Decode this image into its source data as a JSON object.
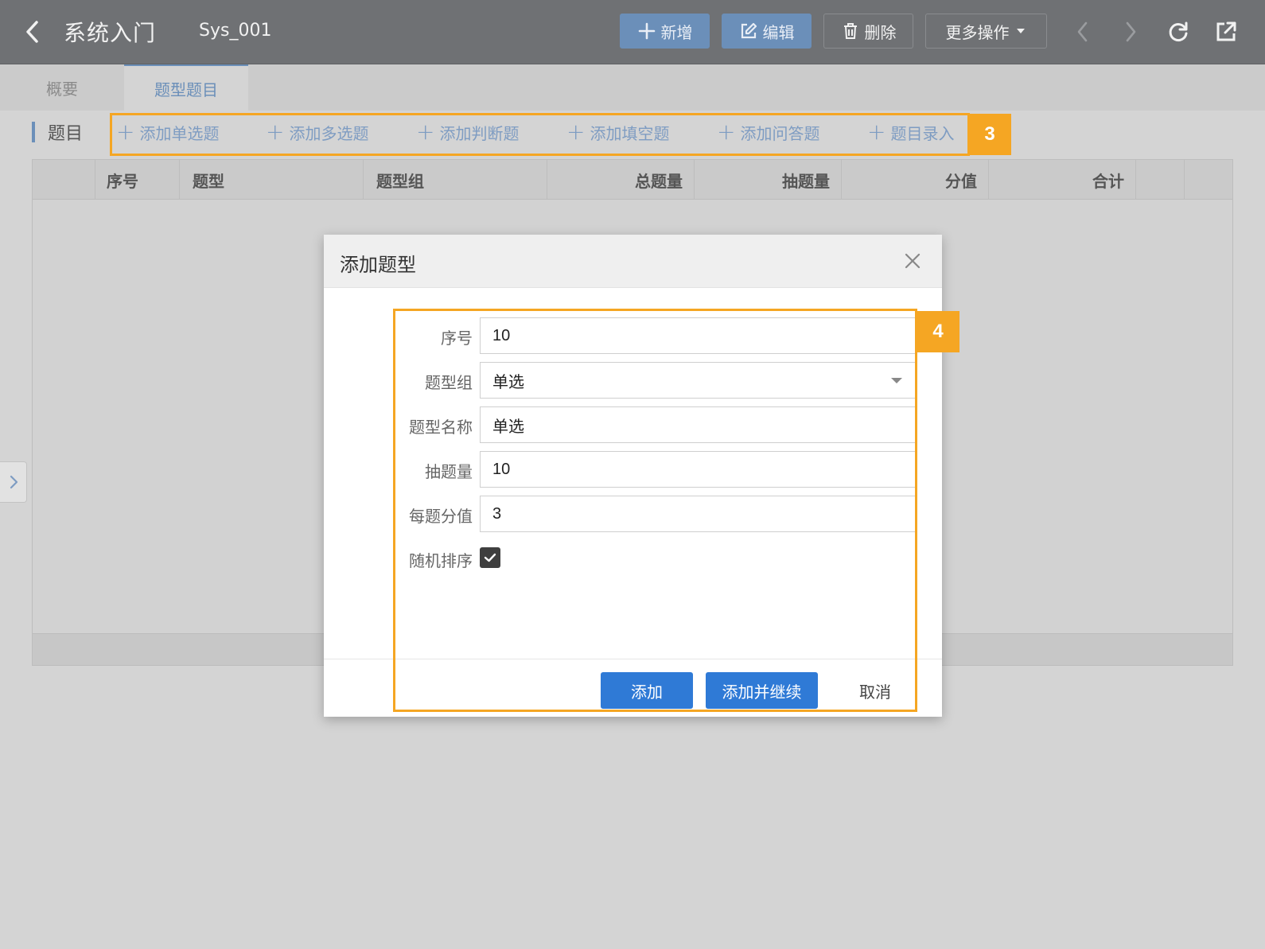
{
  "header": {
    "title": "系统入门",
    "code": "Sys_001",
    "buttons": {
      "add": "新增",
      "edit": "编辑",
      "delete": "删除",
      "more": "更多操作"
    }
  },
  "tabs": [
    {
      "label": "概要",
      "active": false
    },
    {
      "label": "题型题目",
      "active": true
    }
  ],
  "section": {
    "label": "题目",
    "actions": [
      "添加单选题",
      "添加多选题",
      "添加判断题",
      "添加填空题",
      "添加问答题",
      "题目录入"
    ]
  },
  "callouts": {
    "toolbar_badge": "3",
    "form_badge": "4",
    "color": "#f5a623"
  },
  "table": {
    "columns": [
      "序号",
      "题型",
      "题型组",
      "总题量",
      "抽题量",
      "分值",
      "合计"
    ],
    "rows": []
  },
  "dialog": {
    "title": "添加题型",
    "fields": {
      "seq": {
        "label": "序号",
        "value": "10"
      },
      "group": {
        "label": "题型组",
        "value": "单选"
      },
      "name": {
        "label": "题型名称",
        "value": "单选"
      },
      "draw_count": {
        "label": "抽题量",
        "value": "10"
      },
      "score": {
        "label": "每题分值",
        "value": "3"
      },
      "random": {
        "label": "随机排序",
        "checked": true
      }
    },
    "buttons": {
      "add": "添加",
      "add_continue": "添加并继续",
      "cancel": "取消"
    }
  },
  "colors": {
    "header_bg": "#6f7174",
    "accent_blue": "#6b8fb9",
    "primary_button": "#2f7ad6"
  }
}
